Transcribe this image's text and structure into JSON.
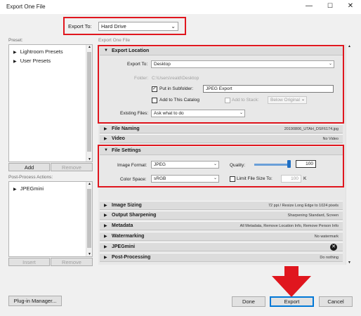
{
  "window": {
    "title": "Export One File"
  },
  "export_to": {
    "label": "Export To:",
    "value": "Hard Drive"
  },
  "preset": {
    "label": "Preset:",
    "items": [
      "Lightroom Presets",
      "User Presets"
    ],
    "add_label": "Add",
    "remove_label": "Remove"
  },
  "export_one_file_label": "Export One File",
  "post_process": {
    "label": "Post-Process Actions:",
    "items": [
      "JPEGmini"
    ],
    "insert_label": "Insert",
    "remove_label": "Remove"
  },
  "export_location": {
    "title": "Export Location",
    "export_to_label": "Export To:",
    "export_to_value": "Desktop",
    "folder_label": "Folder:",
    "folder_value": "C:\\Users\\reald\\Desktop",
    "subfolder_label": "Put in Subfolder:",
    "subfolder_value": "JPEG Export",
    "add_catalog_label": "Add to This Catalog",
    "add_stack_label": "Add to Stack:",
    "stack_value": "Below Original",
    "existing_label": "Existing Files:",
    "existing_value": "Ask what to do"
  },
  "file_naming": {
    "title": "File Naming",
    "summary": "20190806_UTAH_DSF6174.jpg"
  },
  "video": {
    "title": "Video",
    "summary": "No Video"
  },
  "file_settings": {
    "title": "File Settings",
    "format_label": "Image Format:",
    "format_value": "JPEG",
    "quality_label": "Quality:",
    "quality_value": "100",
    "quality_fraction": 1.0,
    "color_label": "Color Space:",
    "color_value": "sRGB",
    "limit_label": "Limit File Size To:",
    "limit_value": "100",
    "limit_unit": "K"
  },
  "collapsed_sections": [
    {
      "title": "Image Sizing",
      "summary": "72 ppi / Resize Long Edge to 1024 pixels"
    },
    {
      "title": "Output Sharpening",
      "summary": "Sharpening Standard, Screen"
    },
    {
      "title": "Metadata",
      "summary": "All Metadata, Remove Location Info, Remove Person Info"
    },
    {
      "title": "Watermarking",
      "summary": "No watermark"
    },
    {
      "title": "JPEGmini",
      "summary": ""
    },
    {
      "title": "Post-Processing",
      "summary": "Do nothing"
    }
  ],
  "buttons": {
    "plugin_manager": "Plug-in Manager...",
    "done": "Done",
    "export": "Export",
    "cancel": "Cancel"
  },
  "colors": {
    "highlight": "#e0161e",
    "export_focus": "#0078d7"
  }
}
